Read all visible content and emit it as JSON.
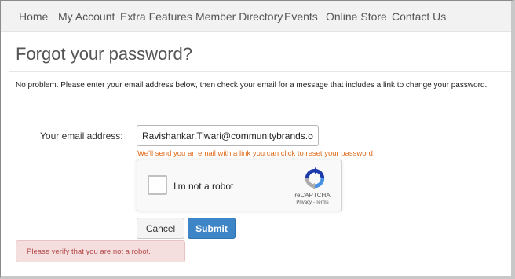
{
  "nav": {
    "items": [
      {
        "label": "Home"
      },
      {
        "label": "My Account"
      },
      {
        "label": "Extra Features"
      },
      {
        "label": "Member Directory"
      },
      {
        "label": "Events"
      },
      {
        "label": "Online Store"
      },
      {
        "label": "Contact Us"
      }
    ]
  },
  "page": {
    "title": "Forgot your password?",
    "intro": "No problem. Please enter your email address below, then check your email for a message that includes a link to change your password."
  },
  "form": {
    "email_label": "Your email address:",
    "email_value": "Ravishankar.Tiwari@communitybrands.com",
    "helper": "We'll send you an email with a link you can click to reset your password.",
    "cancel_label": "Cancel",
    "submit_label": "Submit"
  },
  "recaptcha": {
    "label": "I'm not a robot",
    "brand": "reCAPTCHA",
    "privacy": "Privacy",
    "separator": " - ",
    "terms": "Terms",
    "logo_icon": "recaptcha-logo-icon",
    "checked": false
  },
  "alert": {
    "text": "Please verify that you are not a robot."
  },
  "colors": {
    "accent": "#3d85c6",
    "helper": "#e06b1c",
    "alert_bg": "#f5dede",
    "alert_text": "#b34a4a"
  }
}
